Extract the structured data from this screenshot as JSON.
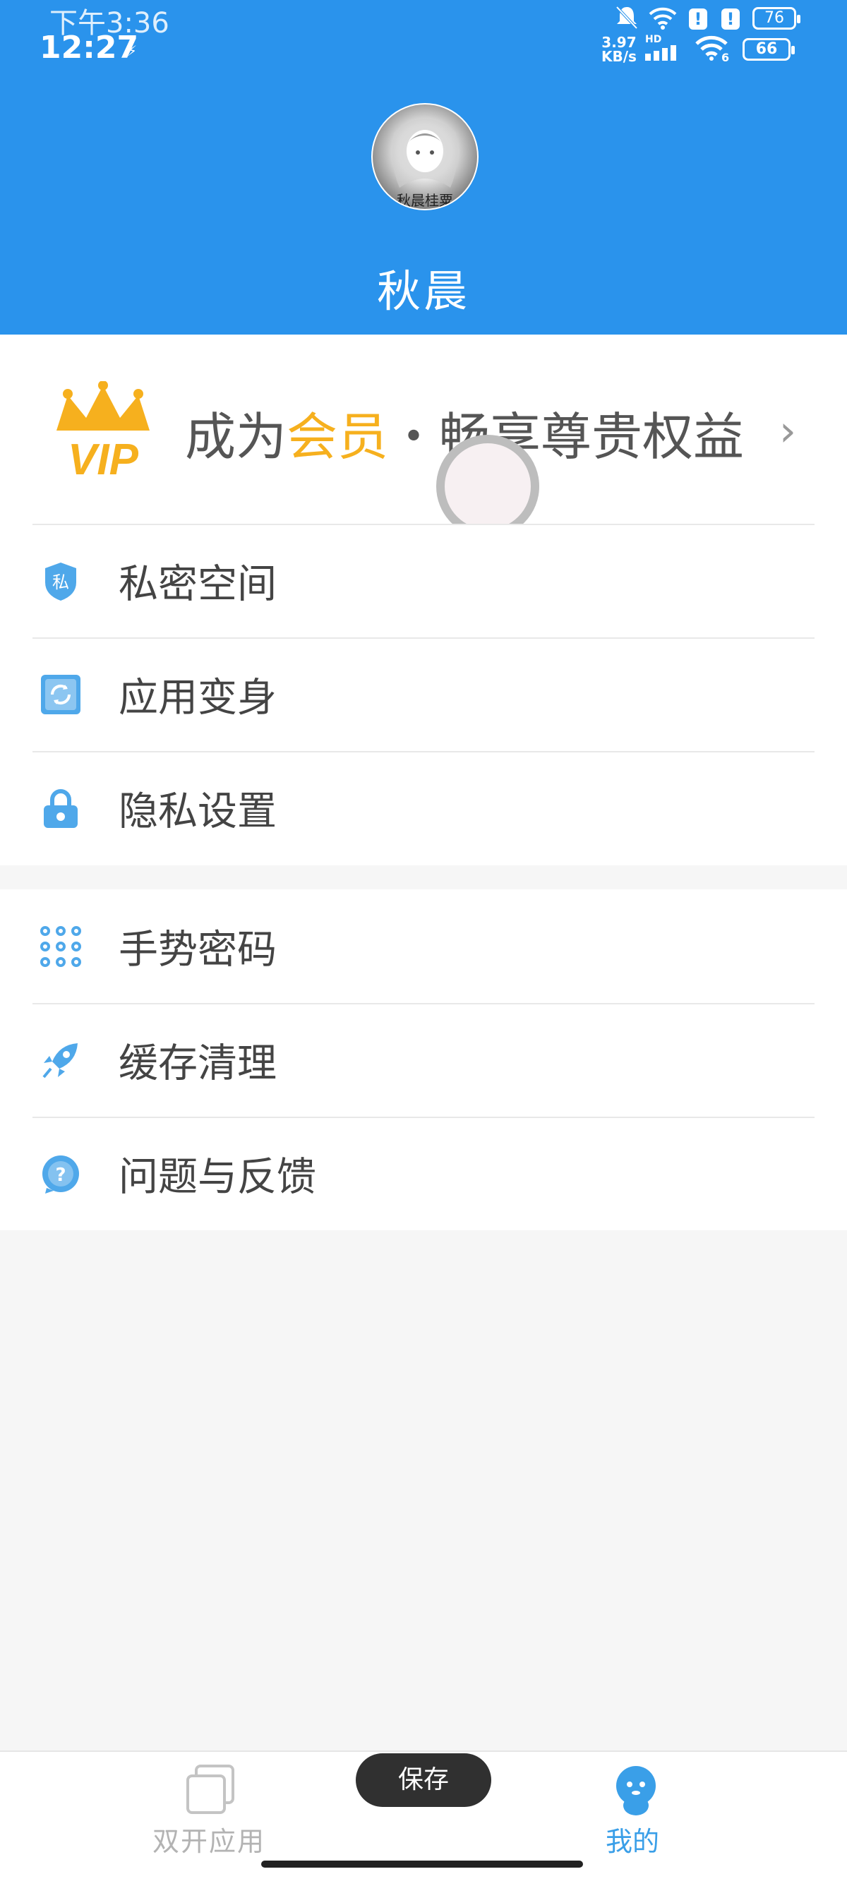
{
  "status_bar": {
    "time_top": "下午3:36",
    "time_main": "12:27",
    "network_speed": "3.97\nKB/s",
    "network_type": "HD",
    "wifi_sub": "6",
    "battery_top": "76",
    "battery_main": "66"
  },
  "profile": {
    "avatar_caption": "秋晨桂粟",
    "username": "秋晨"
  },
  "vip": {
    "prefix": "成为",
    "highlight": "会员",
    "suffix": "・畅享尊贵权益",
    "icon_text": "VIP"
  },
  "menu_group_1": [
    {
      "label": "私密空间",
      "icon": "private-space-icon",
      "icon_text": "私"
    },
    {
      "label": "应用变身",
      "icon": "app-disguise-icon"
    },
    {
      "label": "隐私设置",
      "icon": "lock-icon"
    }
  ],
  "menu_group_2": [
    {
      "label": "手势密码",
      "icon": "gesture-pattern-icon"
    },
    {
      "label": "缓存清理",
      "icon": "rocket-icon"
    },
    {
      "label": "问题与反馈",
      "icon": "help-icon",
      "icon_text": "?"
    }
  ],
  "tabbar": {
    "tab_dual_apps": "双开应用",
    "tab_me": "我的"
  },
  "toast": "保存",
  "colors": {
    "header": "#2a93ec",
    "gold": "#f6b01e",
    "icon_blue": "#4fa8ea",
    "tab_active": "#3a9fe8",
    "tab_inactive": "#b3b3b3"
  }
}
